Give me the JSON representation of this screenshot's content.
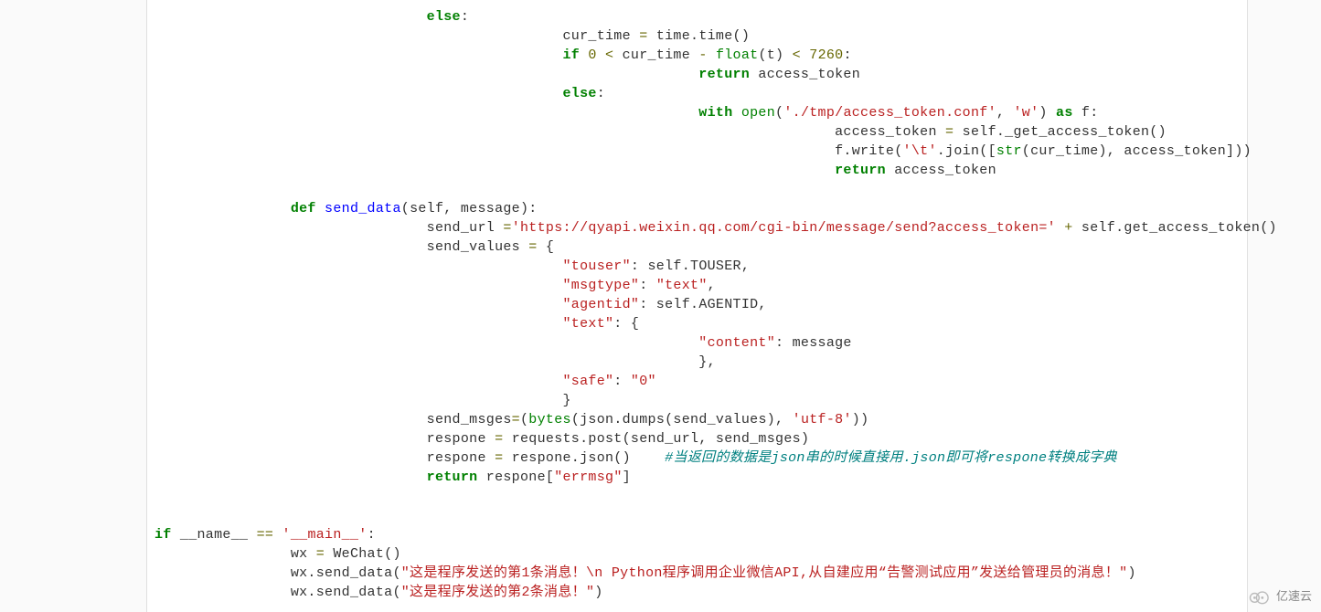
{
  "code_lines": [
    {
      "indent": 8,
      "tokens": [
        {
          "t": "else",
          "c": "kw"
        },
        {
          "t": ":"
        }
      ]
    },
    {
      "indent": 12,
      "tokens": [
        {
          "t": "cur_time "
        },
        {
          "t": "=",
          "c": "op"
        },
        {
          "t": " time.time()"
        }
      ]
    },
    {
      "indent": 12,
      "tokens": [
        {
          "t": "if ",
          "c": "kw"
        },
        {
          "t": "0",
          "c": "num"
        },
        {
          "t": " < ",
          "c": "op"
        },
        {
          "t": "cur_time "
        },
        {
          "t": "- ",
          "c": "op"
        },
        {
          "t": "float",
          "c": "bi"
        },
        {
          "t": "(t) "
        },
        {
          "t": "< ",
          "c": "op"
        },
        {
          "t": "7260",
          "c": "num"
        },
        {
          "t": ":"
        }
      ]
    },
    {
      "indent": 16,
      "tokens": [
        {
          "t": "return ",
          "c": "kw"
        },
        {
          "t": "access_token"
        }
      ]
    },
    {
      "indent": 12,
      "tokens": [
        {
          "t": "else",
          "c": "kw"
        },
        {
          "t": ":"
        }
      ]
    },
    {
      "indent": 16,
      "tokens": [
        {
          "t": "with ",
          "c": "kw"
        },
        {
          "t": "open",
          "c": "bi"
        },
        {
          "t": "("
        },
        {
          "t": "'./tmp/access_token.conf'",
          "c": "str"
        },
        {
          "t": ", "
        },
        {
          "t": "'w'",
          "c": "str"
        },
        {
          "t": ") "
        },
        {
          "t": "as ",
          "c": "kw"
        },
        {
          "t": "f:"
        }
      ]
    },
    {
      "indent": 20,
      "tokens": [
        {
          "t": "access_token "
        },
        {
          "t": "=",
          "c": "op"
        },
        {
          "t": " self._get_access_token()"
        }
      ]
    },
    {
      "indent": 20,
      "tokens": [
        {
          "t": "f.write("
        },
        {
          "t": "'\\t'",
          "c": "str"
        },
        {
          "t": ".join(["
        },
        {
          "t": "str",
          "c": "bi"
        },
        {
          "t": "(cur_time), access_token]))"
        }
      ]
    },
    {
      "indent": 20,
      "tokens": [
        {
          "t": "return ",
          "c": "kw"
        },
        {
          "t": "access_token"
        }
      ]
    },
    {
      "indent": 0,
      "tokens": []
    },
    {
      "indent": 4,
      "tokens": [
        {
          "t": "def ",
          "c": "kw"
        },
        {
          "t": "send_data",
          "c": "fn"
        },
        {
          "t": "(self, message):"
        }
      ]
    },
    {
      "indent": 8,
      "tokens": [
        {
          "t": "send_url "
        },
        {
          "t": "=",
          "c": "op"
        },
        {
          "t": "'https://qyapi.weixin.qq.com/cgi-bin/message/send?access_token='",
          "c": "str"
        },
        {
          "t": " + ",
          "c": "op"
        },
        {
          "t": "self.get_access_token()"
        }
      ]
    },
    {
      "indent": 8,
      "tokens": [
        {
          "t": "send_values "
        },
        {
          "t": "=",
          "c": "op"
        },
        {
          "t": " {"
        }
      ]
    },
    {
      "indent": 12,
      "tokens": [
        {
          "t": "\"touser\"",
          "c": "str"
        },
        {
          "t": ": self.TOUSER,"
        }
      ]
    },
    {
      "indent": 12,
      "tokens": [
        {
          "t": "\"msgtype\"",
          "c": "str"
        },
        {
          "t": ": "
        },
        {
          "t": "\"text\"",
          "c": "str"
        },
        {
          "t": ","
        }
      ]
    },
    {
      "indent": 12,
      "tokens": [
        {
          "t": "\"agentid\"",
          "c": "str"
        },
        {
          "t": ": self.AGENTID,"
        }
      ]
    },
    {
      "indent": 12,
      "tokens": [
        {
          "t": "\"text\"",
          "c": "str"
        },
        {
          "t": ": {"
        }
      ]
    },
    {
      "indent": 16,
      "tokens": [
        {
          "t": "\"content\"",
          "c": "str"
        },
        {
          "t": ": message"
        }
      ]
    },
    {
      "indent": 16,
      "tokens": [
        {
          "t": "},"
        }
      ]
    },
    {
      "indent": 12,
      "tokens": [
        {
          "t": "\"safe\"",
          "c": "str"
        },
        {
          "t": ": "
        },
        {
          "t": "\"0\"",
          "c": "str"
        }
      ]
    },
    {
      "indent": 12,
      "tokens": [
        {
          "t": "}"
        }
      ]
    },
    {
      "indent": 8,
      "tokens": [
        {
          "t": "send_msges"
        },
        {
          "t": "=",
          "c": "op"
        },
        {
          "t": "("
        },
        {
          "t": "bytes",
          "c": "bi"
        },
        {
          "t": "(json.dumps(send_values), "
        },
        {
          "t": "'utf-8'",
          "c": "str"
        },
        {
          "t": "))"
        }
      ]
    },
    {
      "indent": 8,
      "tokens": [
        {
          "t": "respone "
        },
        {
          "t": "=",
          "c": "op"
        },
        {
          "t": " requests.post(send_url, send_msges)"
        }
      ]
    },
    {
      "indent": 8,
      "tokens": [
        {
          "t": "respone "
        },
        {
          "t": "=",
          "c": "op"
        },
        {
          "t": " respone.json()    "
        },
        {
          "t": "#当返回的数据是json串的时候直接用.json即可将respone转换成字典",
          "c": "cmt"
        }
      ]
    },
    {
      "indent": 8,
      "tokens": [
        {
          "t": "return ",
          "c": "kw"
        },
        {
          "t": "respone["
        },
        {
          "t": "\"errmsg\"",
          "c": "str"
        },
        {
          "t": "]"
        }
      ]
    },
    {
      "indent": 0,
      "tokens": []
    },
    {
      "indent": 0,
      "tokens": []
    },
    {
      "indent": 0,
      "tokens": [
        {
          "t": "if ",
          "c": "kw"
        },
        {
          "t": "__name__ "
        },
        {
          "t": "==",
          "c": "op"
        },
        {
          "t": " "
        },
        {
          "t": "'__main__'",
          "c": "str"
        },
        {
          "t": ":"
        }
      ]
    },
    {
      "indent": 4,
      "tokens": [
        {
          "t": "wx "
        },
        {
          "t": "=",
          "c": "op"
        },
        {
          "t": " WeChat()"
        }
      ]
    },
    {
      "indent": 4,
      "tokens": [
        {
          "t": "wx.send_data("
        },
        {
          "t": "\"这是程序发送的第1条消息！\\n Python程序调用企业微信API,从自建应用“告警测试应用”发送给管理员的消息！\"",
          "c": "str"
        },
        {
          "t": ")"
        }
      ]
    },
    {
      "indent": 4,
      "tokens": [
        {
          "t": "wx.send_data("
        },
        {
          "t": "\"这是程序发送的第2条消息！\"",
          "c": "str"
        },
        {
          "t": ")"
        }
      ]
    }
  ],
  "logo": {
    "text": "亿速云"
  }
}
